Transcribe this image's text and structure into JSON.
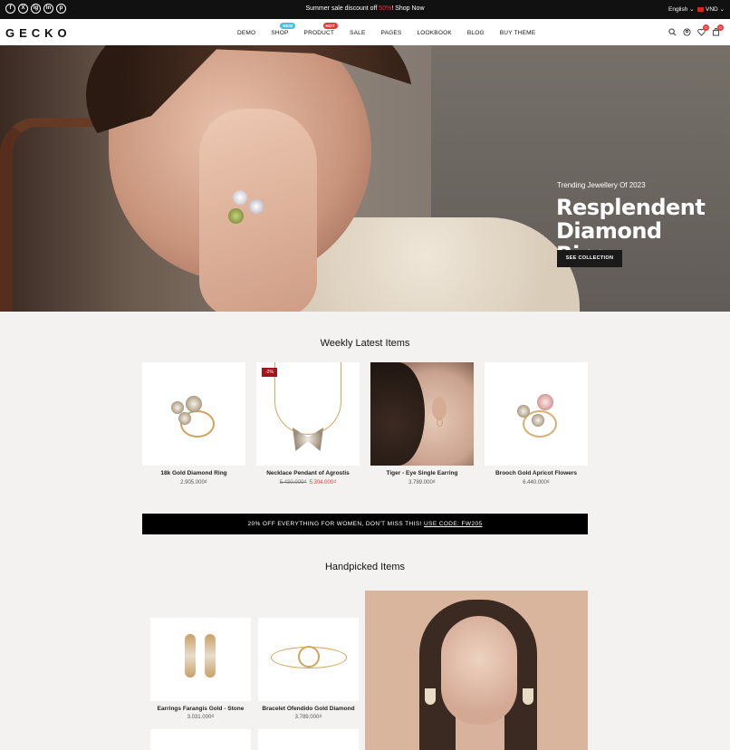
{
  "topbar": {
    "socials": [
      "f",
      "X",
      "ig",
      "in",
      "p"
    ],
    "promo_prefix": "Summer sale discount off ",
    "promo_hot": "50%",
    "promo_suffix": "! Shop Now",
    "language": "English ⌄",
    "currency": "VND ⌄"
  },
  "header": {
    "logo": "GECKO",
    "nav": [
      {
        "label": "DEMO"
      },
      {
        "label": "SHOP",
        "badge": "NEW"
      },
      {
        "label": "PRODUCT",
        "badge": "HOT"
      },
      {
        "label": "SALE"
      },
      {
        "label": "PAGES"
      },
      {
        "label": "LOOKBOOK"
      },
      {
        "label": "BLOG"
      },
      {
        "label": "BUY THEME"
      }
    ],
    "wishlist_count": "0",
    "cart_count": "0"
  },
  "hero": {
    "subtitle": "Trending Jewellery Of 2023",
    "title": "Resplendent Diamond Ring",
    "button": "SEE COLLECTION"
  },
  "weekly": {
    "title": "Weekly Latest Items",
    "products": [
      {
        "name": "18k Gold Diamond Ring",
        "price": "2.905.000₫"
      },
      {
        "name": "Necklace Pendant of Agrostis",
        "old_price": "5.430.000₫",
        "price": "5.304.000₫",
        "tag": "-2%"
      },
      {
        "name": "Tiger - Eye Single Earring",
        "price": "3.789.000₫"
      },
      {
        "name": "Brooch Gold Apricot Flowers",
        "price": "6.440.000₫"
      }
    ]
  },
  "banner": {
    "text": "20% OFF EVERYTHING FOR WOMEN, DON'T MISS THIS! ",
    "code": "USE CODE: FW205"
  },
  "handpicked": {
    "title": "Handpicked Items",
    "products": [
      {
        "name": "Earrings Farangis Gold - Stone",
        "price": "3.031.000₫"
      },
      {
        "name": "Bracelet Ofendido Gold Diamond",
        "price": "3.789.000₫"
      }
    ]
  },
  "colors": {
    "accent": "#e53935",
    "dark": "#111111",
    "new_badge": "#4ac0e0",
    "tag": "#a3171b"
  }
}
